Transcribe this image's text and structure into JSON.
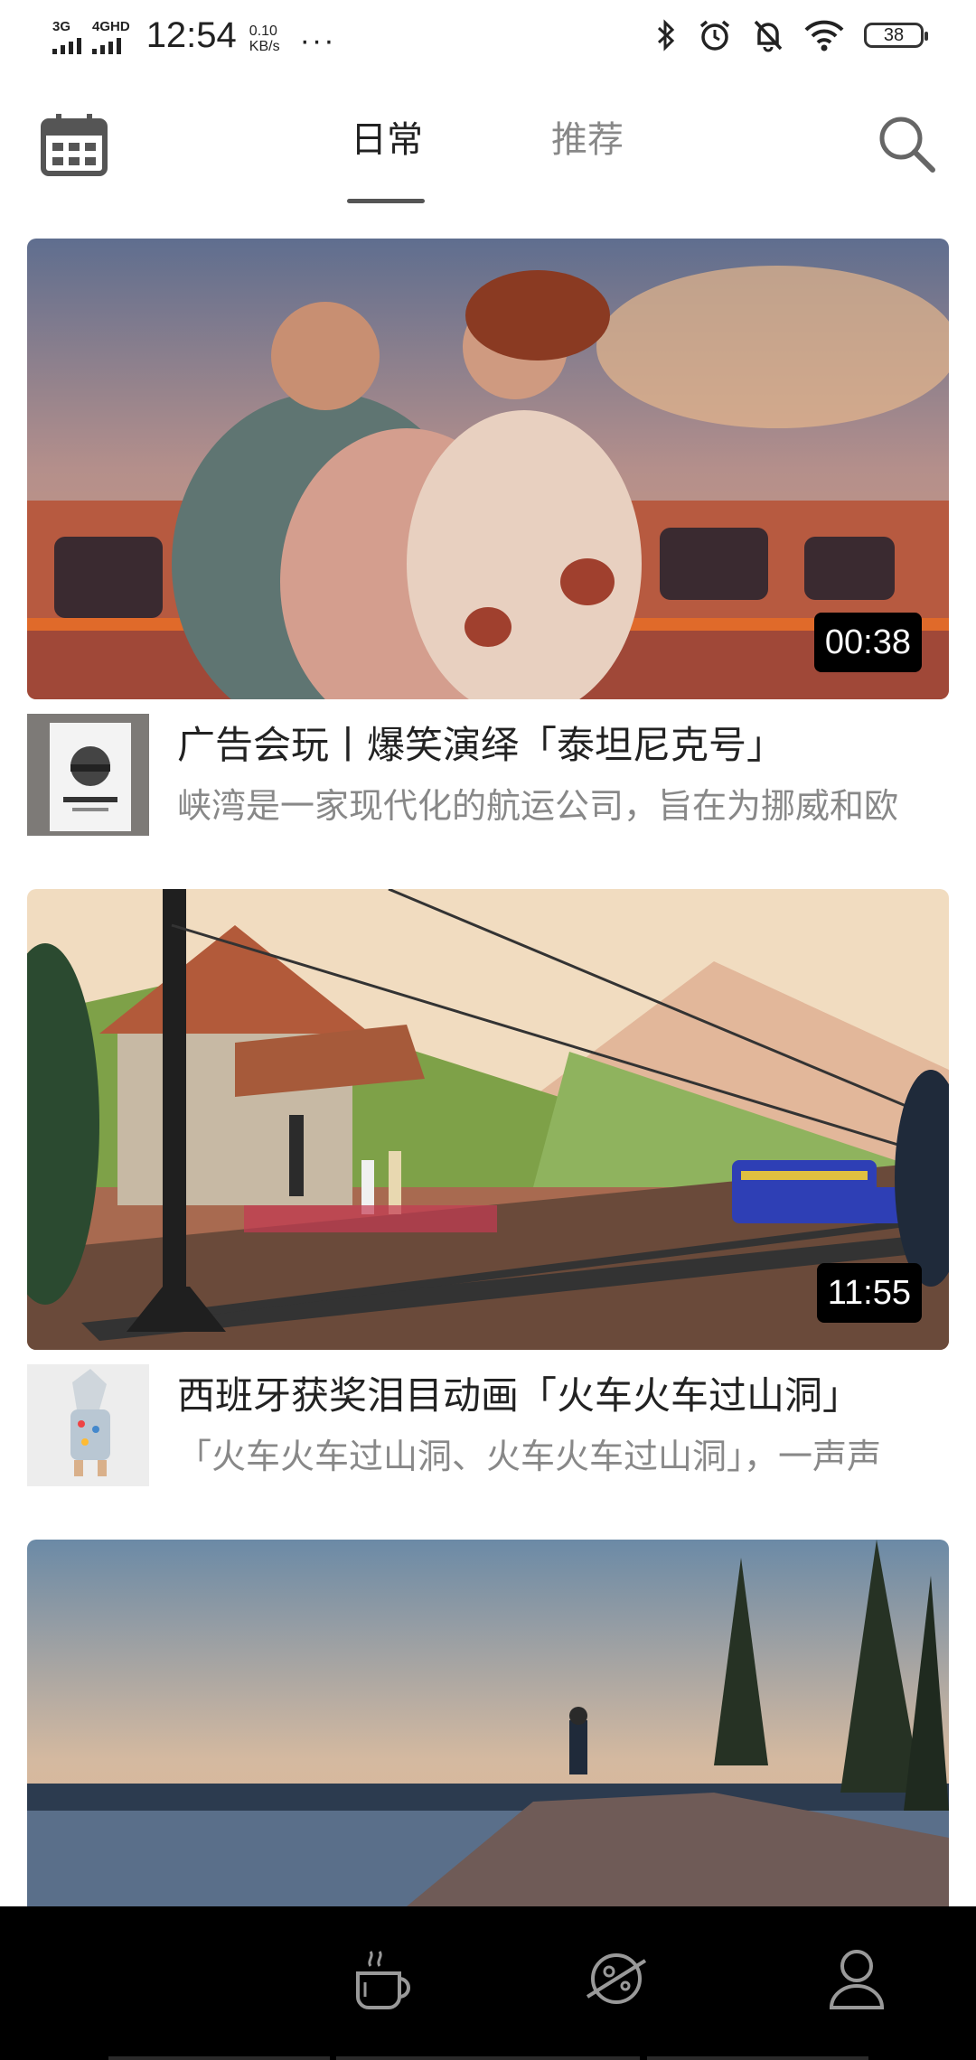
{
  "status_bar": {
    "network_1": "3G",
    "network_2": "4GHD",
    "time": "12:54",
    "speed_value": "0.10",
    "speed_unit": "KB/s",
    "more": "···",
    "battery": "38",
    "icons": [
      "bluetooth-icon",
      "alarm-icon",
      "mute-icon",
      "wifi-icon",
      "battery-icon"
    ]
  },
  "header": {
    "tabs": [
      {
        "label": "日常",
        "active": true
      },
      {
        "label": "推荐",
        "active": false
      }
    ],
    "calendar_icon": "calendar-icon",
    "search_icon": "search-icon"
  },
  "feed": [
    {
      "duration": "00:38",
      "title": "广告会玩丨爆笑演绎「泰坦尼克号」",
      "description": "峡湾是一家现代化的航运公司，旨在为挪威和欧"
    },
    {
      "duration": "11:55",
      "title": "西班牙获奖泪目动画「火车火车过山洞」",
      "description": "「火车火车过山洞、火车火车过山洞」，一声声"
    },
    {
      "duration": "",
      "title": "",
      "description": ""
    }
  ],
  "bottom_nav": {
    "items": [
      {
        "icon": "coffee-cup-icon"
      },
      {
        "icon": "planet-icon"
      },
      {
        "icon": "user-icon"
      }
    ]
  },
  "colors": {
    "tab_active": "#222222",
    "tab_inactive": "#888888",
    "nav_background": "#000000",
    "duration_badge": "#000000"
  }
}
